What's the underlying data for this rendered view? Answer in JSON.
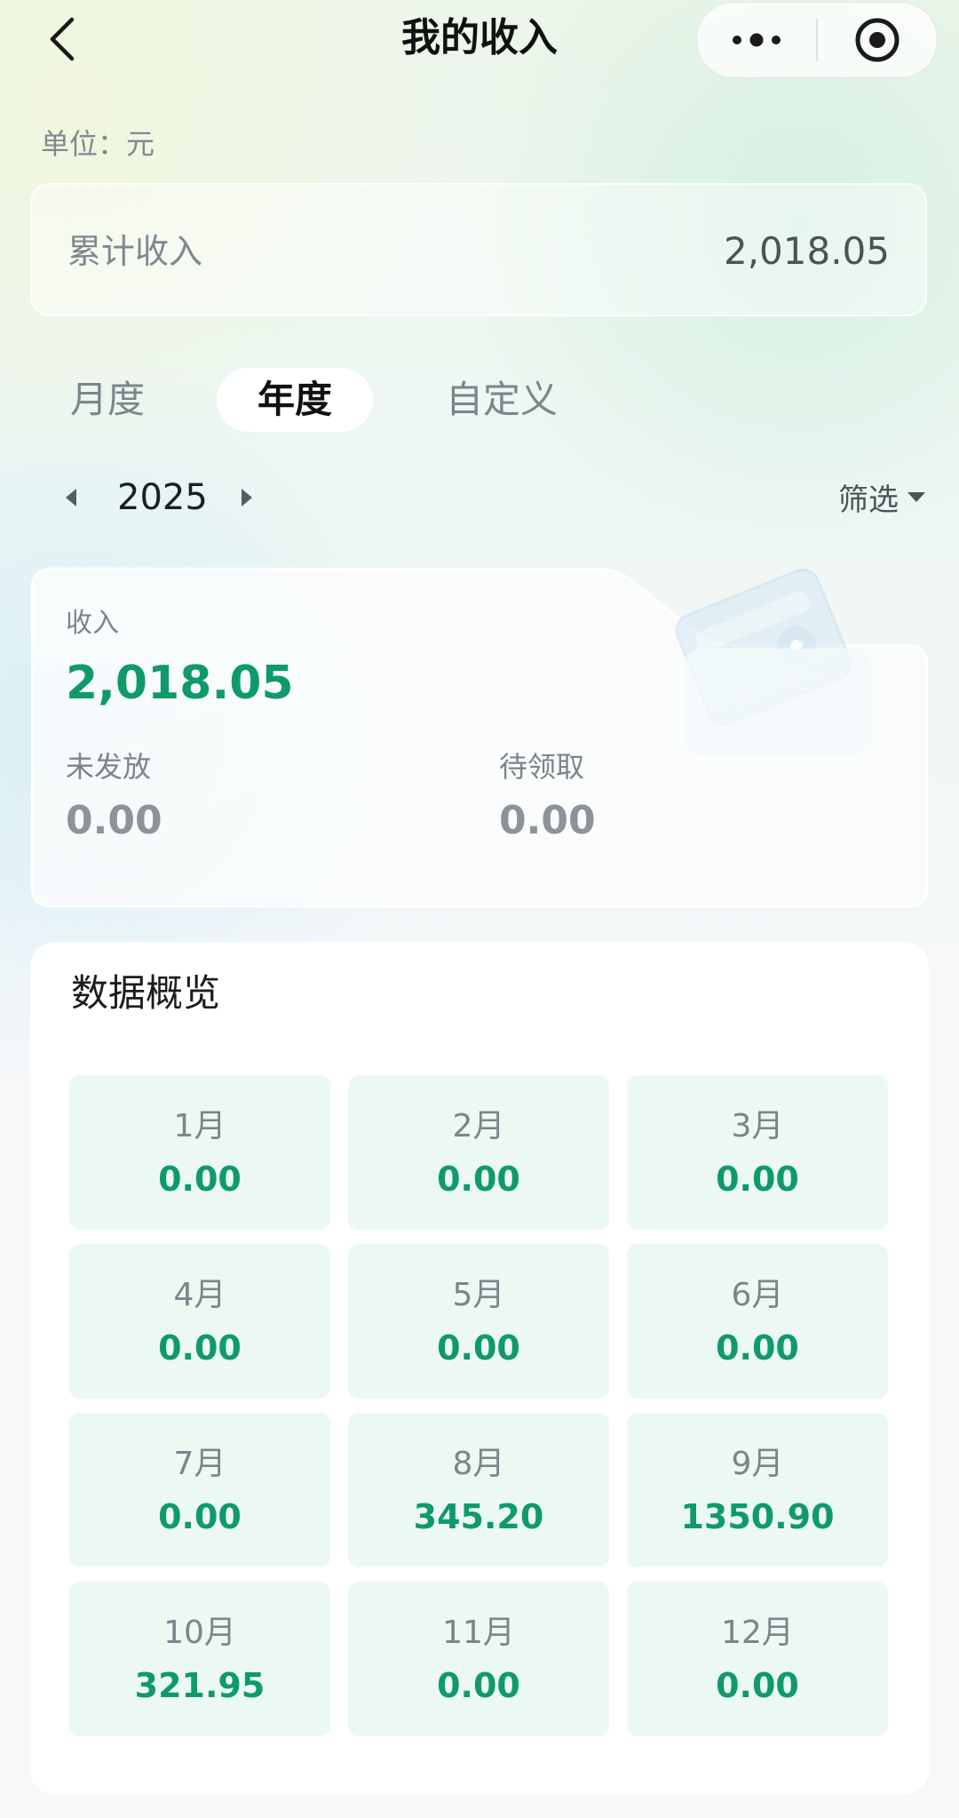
{
  "header": {
    "title": "我的收入",
    "back_icon": "chevron-left-icon",
    "more_icon": "more-dots-icon",
    "target_icon": "target-circle-icon"
  },
  "unit": {
    "label": "单位：元"
  },
  "total": {
    "label": "累计收入",
    "value": "2,018.05"
  },
  "tabs": [
    {
      "label": "月度",
      "selected": false
    },
    {
      "label": "年度",
      "selected": true
    },
    {
      "label": "自定义",
      "selected": false
    }
  ],
  "period": {
    "year": "2025",
    "filter_label": "筛选"
  },
  "income": {
    "title": "收入",
    "value": "2,018.05",
    "unreleased_label": "未发放",
    "unreleased_value": "0.00",
    "pending_label": "待领取",
    "pending_value": "0.00"
  },
  "overview": {
    "title": "数据概览",
    "months": [
      {
        "label": "1月",
        "value": "0.00"
      },
      {
        "label": "2月",
        "value": "0.00"
      },
      {
        "label": "3月",
        "value": "0.00"
      },
      {
        "label": "4月",
        "value": "0.00"
      },
      {
        "label": "5月",
        "value": "0.00"
      },
      {
        "label": "6月",
        "value": "0.00"
      },
      {
        "label": "7月",
        "value": "0.00"
      },
      {
        "label": "8月",
        "value": "345.20"
      },
      {
        "label": "9月",
        "value": "1350.90"
      },
      {
        "label": "10月",
        "value": "321.95"
      },
      {
        "label": "11月",
        "value": "0.00"
      },
      {
        "label": "12月",
        "value": "0.00"
      }
    ]
  },
  "colors": {
    "accent_green": "#109a6c",
    "tile_background": "#ebf9f2",
    "muted_text": "#7c848c"
  }
}
